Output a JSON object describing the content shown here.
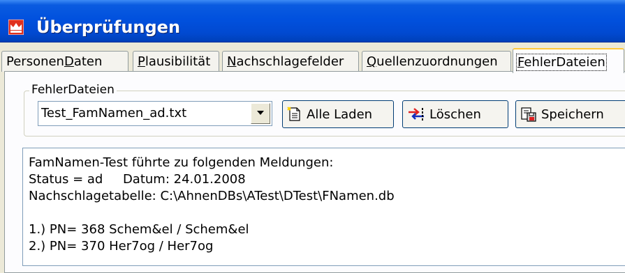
{
  "window": {
    "title": "Überprüfungen"
  },
  "tabs": [
    {
      "pre": "Personen",
      "ul": "D",
      "post": "aten"
    },
    {
      "pre": "",
      "ul": "P",
      "post": "lausibilität"
    },
    {
      "pre": "",
      "ul": "N",
      "post": "achschlagefelder"
    },
    {
      "pre": "",
      "ul": "Q",
      "post": "uellenzuordnungen"
    },
    {
      "pre": "",
      "ul": "F",
      "post": "ehlerDateien"
    }
  ],
  "group": {
    "label": "FehlerDateien"
  },
  "combo": {
    "value": "Test_FamNamen_ad.txt"
  },
  "buttons": {
    "load": "Alle Laden",
    "delete": "Löschen",
    "save": "Speichern"
  },
  "memo": {
    "lines": [
      "FamNamen-Test führte zu folgenden Meldungen:",
      "Status = ad     Datum: 24.01.2008",
      "Nachschlagetabelle: C:\\AhnenDBs\\ATest\\DTest\\FNamen.db",
      "",
      "1.) PN= 368 Schem&el / Schem&el",
      "2.) PN= 370 Her7og / Her7og"
    ]
  },
  "colors": {
    "titlebar": "#0151DE",
    "active_tab_accent": "#FFC83C",
    "window_bg": "#ECE9D8"
  }
}
